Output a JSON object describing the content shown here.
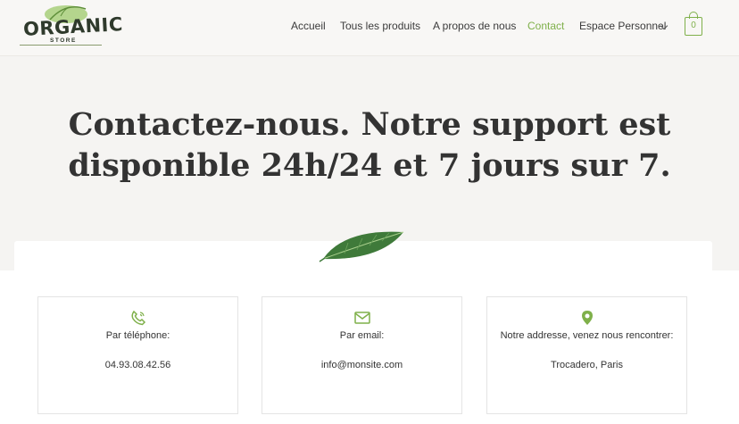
{
  "header": {
    "logo_word": "ORGANIC",
    "logo_sub": "STORE",
    "nav": [
      {
        "label": "Accueil"
      },
      {
        "label": "Tous les produits"
      },
      {
        "label": "A propos de nous"
      },
      {
        "label": "Contact",
        "active": true
      },
      {
        "label": "Espace Personnel",
        "has_dropdown": true
      }
    ],
    "cart_count": "0",
    "accent_color": "#7fb04a"
  },
  "hero": {
    "title": "Contactez-nous. Notre support est disponible 24h/24 et 7 jours sur 7."
  },
  "contact_cards": [
    {
      "icon": "phone-icon",
      "label": "Par téléphone:",
      "value": "04.93.08.42.56"
    },
    {
      "icon": "email-icon",
      "label": "Par email:",
      "value": "info@monsite.com"
    },
    {
      "icon": "location-pin-icon",
      "label": "Notre addresse, venez nous rencontrer:",
      "value": "Trocadero, Paris"
    }
  ]
}
